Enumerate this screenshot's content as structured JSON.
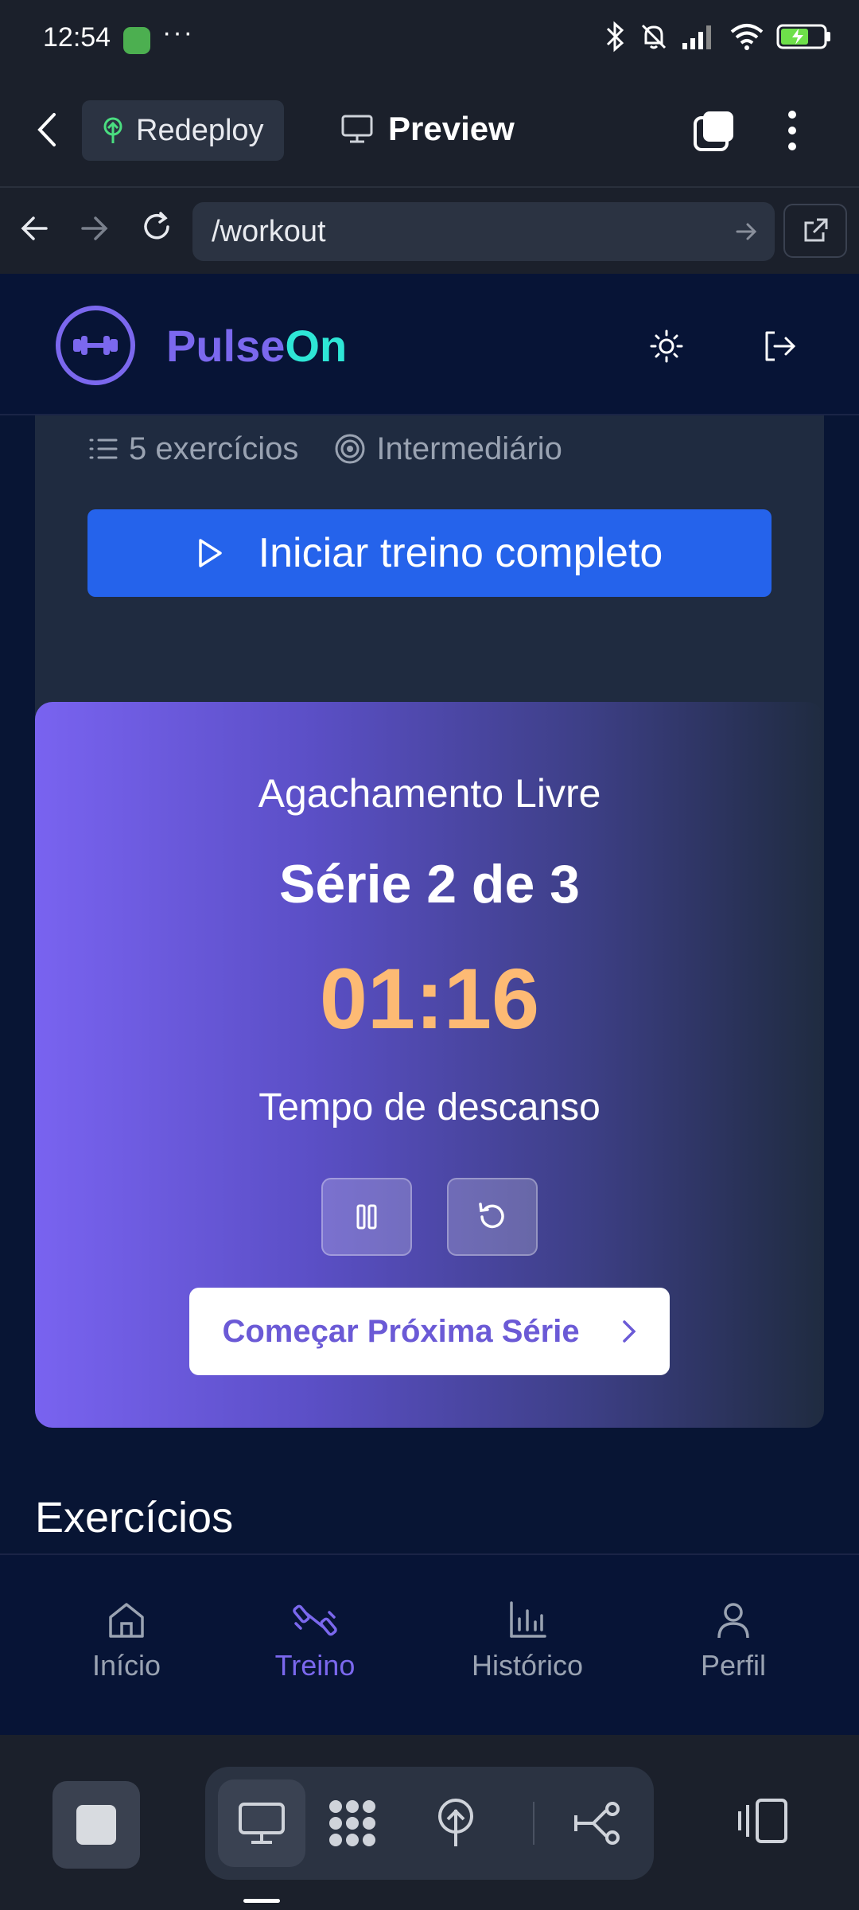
{
  "status_bar": {
    "time": "12:54",
    "more": "···"
  },
  "browser": {
    "redeploy_label": "Redeploy",
    "preview_label": "Preview",
    "url": "/workout"
  },
  "app": {
    "brand_part1": "Pulse",
    "brand_part2": "On"
  },
  "workout": {
    "exercise_count": "5 exercícios",
    "level": "Intermediário",
    "start_button": "Iniciar treino completo"
  },
  "rest_timer": {
    "exercise_name": "Agachamento Livre",
    "series": "Série 2 de 3",
    "time": "01:16",
    "label": "Tempo de descanso",
    "next_button": "Começar Próxima Série"
  },
  "exercises_section": {
    "title": "Exercícios"
  },
  "bottom_nav": {
    "items": [
      {
        "label": "Início",
        "active": false
      },
      {
        "label": "Treino",
        "active": true
      },
      {
        "label": "Histórico",
        "active": false
      },
      {
        "label": "Perfil",
        "active": false
      }
    ]
  },
  "colors": {
    "accent": "#7b68ee",
    "brand_secondary": "#2ee6d6",
    "primary_button": "#2563eb",
    "timer": "#fdba74"
  }
}
